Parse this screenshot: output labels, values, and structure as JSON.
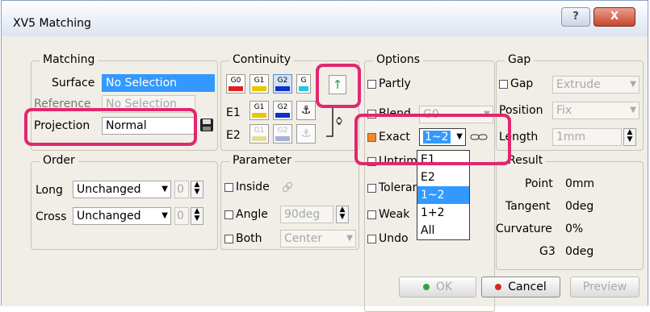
{
  "window": {
    "title": "XV5 Matching",
    "help_glyph": "?",
    "close_glyph": "X"
  },
  "matching": {
    "group_label": "Matching",
    "surface_label": "Surface",
    "surface_value": "No Selection",
    "reference_label": "Reference",
    "reference_value": "No Selection",
    "projection_label": "Projection",
    "projection_value": "Normal",
    "save_icon": "floppy-disk-icon"
  },
  "continuity": {
    "group_label": "Continuity",
    "row1": [
      "G0",
      "G1",
      "G2",
      "G"
    ],
    "row1_colors": [
      "#e02020",
      "#e8c800",
      "#1030c8",
      "#20c8e0"
    ],
    "arrow_glyph": "↑",
    "e1_label": "E1",
    "e2_label": "E2",
    "row2": [
      "G1",
      "G2"
    ],
    "row3": [
      "G1",
      "G2"
    ],
    "anchor_glyph": "⚓"
  },
  "options": {
    "group_label": "Options",
    "partly": "Partly",
    "blend": "Blend",
    "blend_value": "G0",
    "exact": "Exact",
    "exact_value": "1~2",
    "untrim": "Untrim",
    "tolerance": "Toleran",
    "weak": "Weak",
    "undo": "Undo",
    "dropdown_options": [
      "E1",
      "E2",
      "1~2",
      "1+2",
      "All"
    ],
    "dropdown_selected": "1~2"
  },
  "gap": {
    "group_label": "Gap",
    "gap_label": "Gap",
    "gap_value": "Extrude",
    "position_label": "Position",
    "position_value": "Fix",
    "length_label": "Length",
    "length_value": "1mm"
  },
  "order": {
    "group_label": "Order",
    "long_label": "Long",
    "long_value": "Unchanged",
    "long_num": "0",
    "cross_label": "Cross",
    "cross_value": "Unchanged",
    "cross_num": "0"
  },
  "parameter": {
    "group_label": "Parameter",
    "inside": "Inside",
    "angle": "Angle",
    "angle_value": "90deg",
    "both": "Both",
    "both_value": "Center"
  },
  "result": {
    "group_label": "Result",
    "point_label": "Point",
    "point_value": "0mm",
    "tangent_label": "Tangent",
    "tangent_value": "0deg",
    "curvature_label": "Curvature",
    "curvature_value": "0%",
    "g3_label": "G3",
    "g3_value": "0deg"
  },
  "buttons": {
    "ok": "OK",
    "cancel": "Cancel",
    "preview": "Preview"
  },
  "colors": {
    "highlight": "#e0286e",
    "selection": "#3399ff",
    "checkbox_on": "#ee8a2c"
  }
}
